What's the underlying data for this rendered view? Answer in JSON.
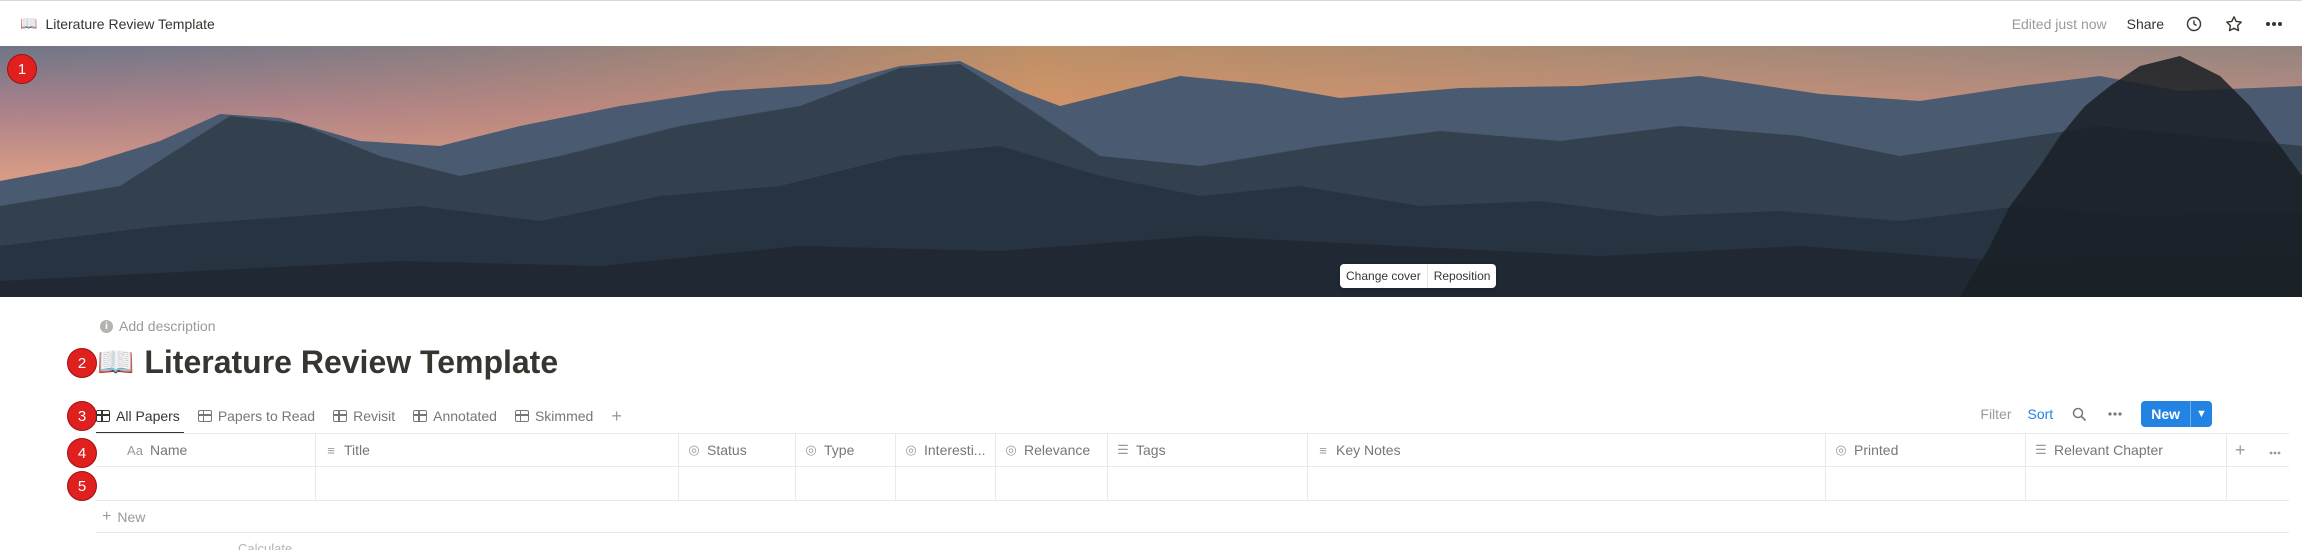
{
  "topbar": {
    "page_emoji": "📖",
    "breadcrumb": "Literature Review Template",
    "edited": "Edited just now",
    "share": "Share",
    "icons": [
      "clock-icon",
      "star-icon",
      "more-icon"
    ]
  },
  "cover": {
    "change_cover": "Change cover",
    "reposition": "Reposition"
  },
  "markers": [
    "1",
    "2",
    "3",
    "4",
    "5"
  ],
  "page": {
    "add_description": "Add description",
    "emoji": "📖",
    "title": "Literature Review Template"
  },
  "views": {
    "tabs": [
      {
        "label": "All Papers",
        "active": true
      },
      {
        "label": "Papers to Read"
      },
      {
        "label": "Revisit"
      },
      {
        "label": "Annotated"
      },
      {
        "label": "Skimmed"
      }
    ],
    "add": "+",
    "filter": "Filter",
    "sort": "Sort",
    "new": "New"
  },
  "table": {
    "columns": [
      {
        "label": "Name",
        "icon": "Aa"
      },
      {
        "label": "Title",
        "icon": "≡"
      },
      {
        "label": "Status",
        "icon": "◎"
      },
      {
        "label": "Type",
        "icon": "◎"
      },
      {
        "label": "Interesti...",
        "icon": "◎"
      },
      {
        "label": "Relevance",
        "icon": "◎"
      },
      {
        "label": "Tags",
        "icon": "☰"
      },
      {
        "label": "Key Notes",
        "icon": "≡"
      },
      {
        "label": "Printed",
        "icon": "◎"
      },
      {
        "label": "Relevant Chapter",
        "icon": "☰"
      }
    ],
    "new_row": "New",
    "calculate": "Calculate"
  },
  "colors": {
    "accent": "#2383e2",
    "marker": "#e0201e",
    "text": "#37352f",
    "muted": "#9b9a97"
  }
}
